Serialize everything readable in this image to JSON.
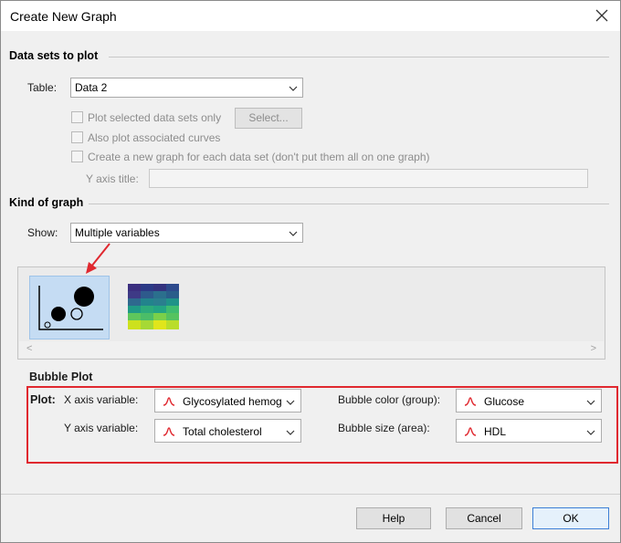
{
  "window": {
    "title": "Create New Graph"
  },
  "data_sets": {
    "header": "Data sets to plot",
    "table_label": "Table:",
    "table_value": "Data 2",
    "plot_selected_label": "Plot selected data sets only",
    "select_button": "Select...",
    "also_plot_label": "Also plot associated curves",
    "new_graph_label": "Create a new graph for each data set (don't put them all on one graph)",
    "y_axis_title_label": "Y axis title:",
    "y_axis_title_value": ""
  },
  "kind_of_graph": {
    "header": "Kind of graph",
    "show_label": "Show:",
    "show_value": "Multiple variables",
    "gallery": [
      {
        "name": "bubble-plot-thumbnail",
        "selected": true
      },
      {
        "name": "heatmap-thumbnail",
        "selected": false
      }
    ]
  },
  "bubble_plot": {
    "header": "Bubble Plot",
    "plot_label": "Plot:",
    "x_axis_label": "X axis variable:",
    "x_axis_value": "Glycosylated hemog",
    "y_axis_label": "Y axis variable:",
    "y_axis_value": "Total cholesterol",
    "color_label": "Bubble color (group):",
    "color_value": "Glucose",
    "size_label": "Bubble size (area):",
    "size_value": "HDL"
  },
  "buttons": {
    "help": "Help",
    "cancel": "Cancel",
    "ok": "OK"
  },
  "colors": {
    "highlight_box": "#e0282f",
    "selection": "#c5dcf3",
    "distribution_icon": "#e0282f",
    "ok_border": "#3c7fd6"
  },
  "icons": [
    "close-icon",
    "chevron-down-icon",
    "distribution-icon",
    "annotation-arrow-icon",
    "bubble-plot-icon",
    "heatmap-icon",
    "scroll-left-icon",
    "scroll-right-icon"
  ]
}
